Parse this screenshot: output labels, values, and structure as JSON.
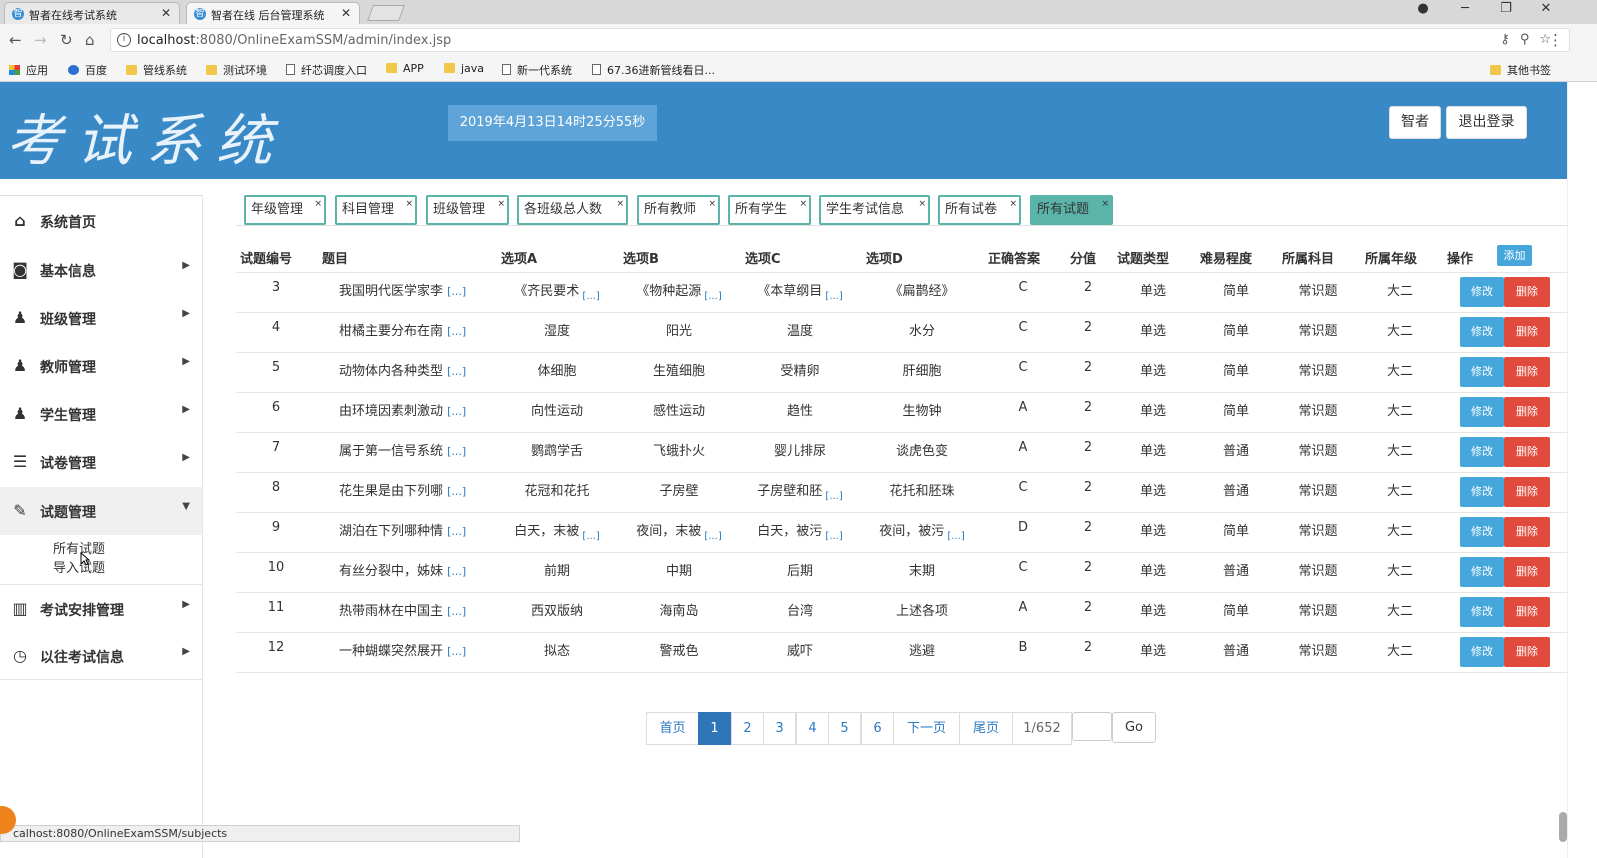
{
  "browser": {
    "tabs": [
      {
        "title": "智者在线考试系统",
        "active": false
      },
      {
        "title": "智者在线 后台管理系统",
        "active": true
      }
    ],
    "url_host": "localhost",
    "url_rest": ":8080/OnlineExamSSM/admin/index.jsp",
    "bookmarks": [
      "应用",
      "百度",
      "管线系统",
      "测试环境",
      "纤芯调度入口",
      "APP",
      "java",
      "新一代系统",
      "67.36进新管线看日..."
    ],
    "other_bookmarks": "其他书签",
    "status_url": "calhost:8080/OnlineExamSSM/subjects"
  },
  "header": {
    "logo_text": "考试系统",
    "datetime": "2019年4月13日14时25分55秒",
    "user_button": "智者",
    "logout_button": "退出登录"
  },
  "sidebar": {
    "items": [
      {
        "label": "系统首页",
        "icon": "home-icon"
      },
      {
        "label": "基本信息",
        "icon": "info-icon"
      },
      {
        "label": "班级管理",
        "icon": "user-icon"
      },
      {
        "label": "教师管理",
        "icon": "user-icon"
      },
      {
        "label": "学生管理",
        "icon": "user-icon"
      },
      {
        "label": "试卷管理",
        "icon": "paper-icon"
      },
      {
        "label": "试题管理",
        "icon": "edit-icon"
      },
      {
        "label": "考试安排管理",
        "icon": "books-icon"
      },
      {
        "label": "以往考试信息",
        "icon": "clock-icon"
      }
    ],
    "subitems": [
      "所有试题",
      "导入试题"
    ]
  },
  "tags": [
    "年级管理",
    "科目管理",
    "班级管理",
    "各班级总人数",
    "所有教师",
    "所有学生",
    "学生考试信息",
    "所有试卷",
    "所有试题"
  ],
  "tag_close": "×",
  "table": {
    "headers": [
      "试题编号",
      "题目",
      "选项A",
      "选项B",
      "选项C",
      "选项D",
      "正确答案",
      "分值",
      "试题类型",
      "难易程度",
      "所属科目",
      "所属年级",
      "操作"
    ],
    "add_label": "添加",
    "edit_label": "修改",
    "delete_label": "删除",
    "more": "[...]",
    "rows": [
      {
        "id": "3",
        "title": "我国明代医学家李",
        "a": "《齐民要术",
        "a_more": true,
        "b": "《物种起源",
        "b_more": true,
        "c": "《本草纲目",
        "c_more": true,
        "d": "《扁鹊经》",
        "d_more": false,
        "answer": "C",
        "score": "2",
        "type": "单选",
        "difficulty": "简单",
        "subject": "常识题",
        "grade": "大二"
      },
      {
        "id": "4",
        "title": "柑橘主要分布在南",
        "a": "湿度",
        "a_more": false,
        "b": "阳光",
        "b_more": false,
        "c": "温度",
        "c_more": false,
        "d": "水分",
        "d_more": false,
        "answer": "C",
        "score": "2",
        "type": "单选",
        "difficulty": "简单",
        "subject": "常识题",
        "grade": "大二"
      },
      {
        "id": "5",
        "title": "动物体内各种类型",
        "a": "体细胞",
        "a_more": false,
        "b": "生殖细胞",
        "b_more": false,
        "c": "受精卵",
        "c_more": false,
        "d": "肝细胞",
        "d_more": false,
        "answer": "C",
        "score": "2",
        "type": "单选",
        "difficulty": "简单",
        "subject": "常识题",
        "grade": "大二"
      },
      {
        "id": "6",
        "title": "由环境因素刺激动",
        "a": "向性运动",
        "a_more": false,
        "b": "感性运动",
        "b_more": false,
        "c": "趋性",
        "c_more": false,
        "d": "生物钟",
        "d_more": false,
        "answer": "A",
        "score": "2",
        "type": "单选",
        "difficulty": "简单",
        "subject": "常识题",
        "grade": "大二"
      },
      {
        "id": "7",
        "title": "属于第一信号系统",
        "a": "鹦鹉学舌",
        "a_more": false,
        "b": "飞蛾扑火",
        "b_more": false,
        "c": "婴儿排尿",
        "c_more": false,
        "d": "谈虎色变",
        "d_more": false,
        "answer": "A",
        "score": "2",
        "type": "单选",
        "difficulty": "普通",
        "subject": "常识题",
        "grade": "大二"
      },
      {
        "id": "8",
        "title": "花生果是由下列哪",
        "a": "花冠和花托",
        "a_more": false,
        "b": "子房壁",
        "b_more": false,
        "c": "子房壁和胚",
        "c_more": true,
        "d": "花托和胚珠",
        "d_more": false,
        "answer": "C",
        "score": "2",
        "type": "单选",
        "difficulty": "普通",
        "subject": "常识题",
        "grade": "大二"
      },
      {
        "id": "9",
        "title": "湖泊在下列哪种情",
        "a": "白天，末被",
        "a_more": true,
        "b": "夜间，末被",
        "b_more": true,
        "c": "白天，被污",
        "c_more": true,
        "d": "夜间，被污",
        "d_more": true,
        "answer": "D",
        "score": "2",
        "type": "单选",
        "difficulty": "简单",
        "subject": "常识题",
        "grade": "大二"
      },
      {
        "id": "10",
        "title": "有丝分裂中，姊妹",
        "a": "前期",
        "a_more": false,
        "b": "中期",
        "b_more": false,
        "c": "后期",
        "c_more": false,
        "d": "末期",
        "d_more": false,
        "answer": "C",
        "score": "2",
        "type": "单选",
        "difficulty": "普通",
        "subject": "常识题",
        "grade": "大二"
      },
      {
        "id": "11",
        "title": "热带雨林在中国主",
        "a": "西双版纳",
        "a_more": false,
        "b": "海南岛",
        "b_more": false,
        "c": "台湾",
        "c_more": false,
        "d": "上述各项",
        "d_more": false,
        "answer": "A",
        "score": "2",
        "type": "单选",
        "difficulty": "简单",
        "subject": "常识题",
        "grade": "大二"
      },
      {
        "id": "12",
        "title": "一种蝴蝶突然展开",
        "a": "拟态",
        "a_more": false,
        "b": "警戒色",
        "b_more": false,
        "c": "威吓",
        "c_more": false,
        "d": "逃避",
        "d_more": false,
        "answer": "B",
        "score": "2",
        "type": "单选",
        "difficulty": "普通",
        "subject": "常识题",
        "grade": "大二"
      }
    ]
  },
  "pagination": {
    "first": "首页",
    "pages": [
      "1",
      "2",
      "3",
      "4",
      "5",
      "6"
    ],
    "current": "1",
    "next": "下一页",
    "last": "尾页",
    "page_info": "1/652",
    "go": "Go"
  },
  "colors": {
    "header_bg": "#3989c7",
    "tag_border": "#5bb4aa",
    "edit_btn": "#45a6dc",
    "delete_btn": "#e04b3e",
    "pager_active": "#2e76b8"
  }
}
